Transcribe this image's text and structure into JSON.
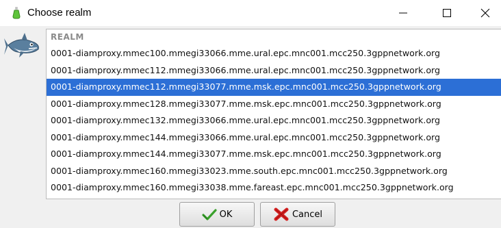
{
  "window": {
    "title": "Choose realm"
  },
  "list": {
    "column_header": "REALM",
    "selected_index": 2,
    "rows": [
      "0001-diamproxy.mmec100.mmegi33066.mme.ural.epc.mnc001.mcc250.3gppnetwork.org",
      "0001-diamproxy.mmec112.mmegi33066.mme.ural.epc.mnc001.mcc250.3gppnetwork.org",
      "0001-diamproxy.mmec112.mmegi33077.mme.msk.epc.mnc001.mcc250.3gppnetwork.org",
      "0001-diamproxy.mmec128.mmegi33077.mme.msk.epc.mnc001.mcc250.3gppnetwork.org",
      "0001-diamproxy.mmec132.mmegi33066.mme.ural.epc.mnc001.mcc250.3gppnetwork.org",
      "0001-diamproxy.mmec144.mmegi33066.mme.ural.epc.mnc001.mcc250.3gppnetwork.org",
      "0001-diamproxy.mmec144.mmegi33077.mme.msk.epc.mnc001.mcc250.3gppnetwork.org",
      "0001-diamproxy.mmec160.mmegi33023.mme.south.epc.mnc001.mcc250.3gppnetwork.org",
      "0001-diamproxy.mmec160.mmegi33038.mme.fareast.epc.mnc001.mcc250.3gppnetwork.org"
    ]
  },
  "buttons": {
    "ok_label": "OK",
    "cancel_label": "Cancel"
  },
  "icons": {
    "app": "flask-icon",
    "minimize": "minimize-icon",
    "maximize": "maximize-icon",
    "close": "close-icon",
    "mascot": "shark-icon",
    "ok": "checkmark-arrow-icon",
    "cancel": "red-x-icon"
  },
  "colors": {
    "selection": "#2c6fd6",
    "header_text": "#8a8a8a"
  }
}
